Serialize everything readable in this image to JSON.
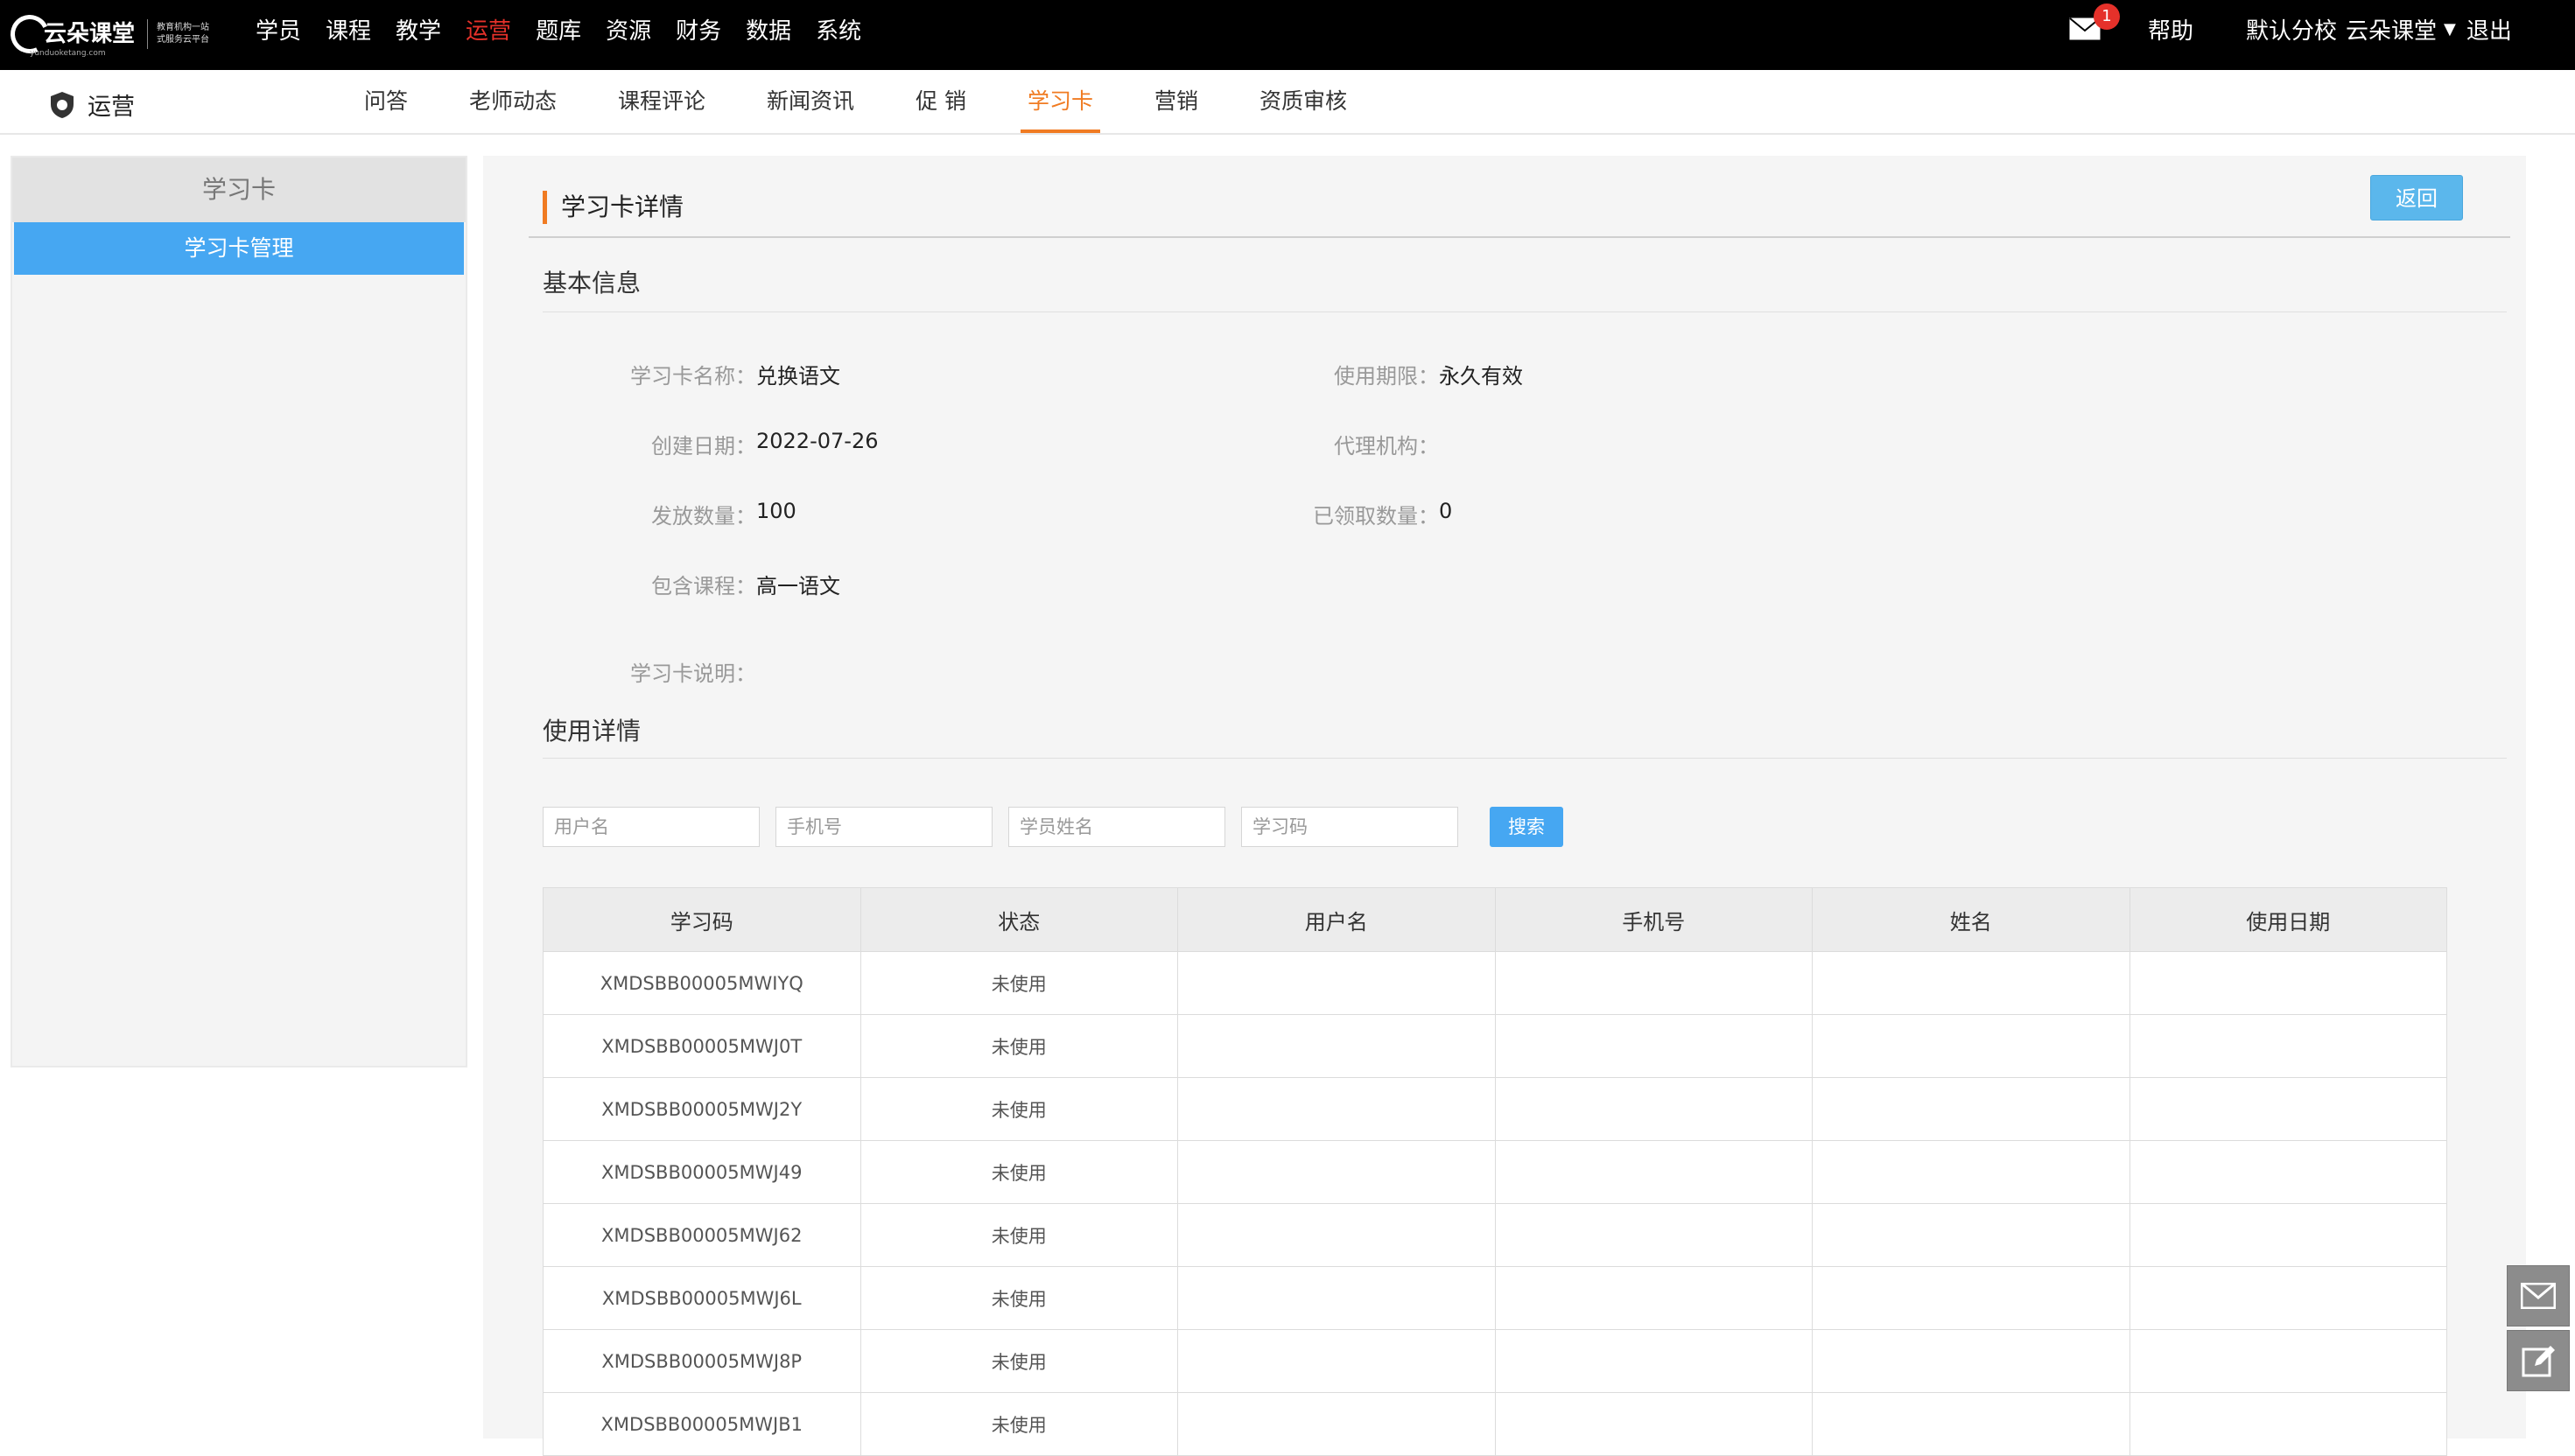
{
  "brand": {
    "name": "云朵课堂",
    "domain": "yunduoketang.com",
    "tagline_line1": "教育机构一站",
    "tagline_line2": "式服务云平台"
  },
  "top_nav": [
    {
      "label": "学员"
    },
    {
      "label": "课程"
    },
    {
      "label": "教学"
    },
    {
      "label": "运营",
      "active": true
    },
    {
      "label": "题库"
    },
    {
      "label": "资源"
    },
    {
      "label": "财务"
    },
    {
      "label": "数据"
    },
    {
      "label": "系统"
    }
  ],
  "header_right": {
    "mail_count": "1",
    "help": "帮助",
    "school": "默认分校",
    "org": "云朵课堂",
    "logout": "退出"
  },
  "module_title": "运营",
  "sub_nav": [
    {
      "label": "问答"
    },
    {
      "label": "老师动态"
    },
    {
      "label": "课程评论"
    },
    {
      "label": "新闻资讯"
    },
    {
      "label": "促 销"
    },
    {
      "label": "学习卡",
      "active": true
    },
    {
      "label": "营销"
    },
    {
      "label": "资质审核"
    }
  ],
  "sidebar": {
    "title": "学习卡",
    "items": [
      {
        "label": "学习卡管理"
      }
    ]
  },
  "panel": {
    "title": "学习卡详情",
    "back": "返回"
  },
  "basic_info": {
    "section_title": "基本信息",
    "card_name_label": "学习卡名称：",
    "card_name": "兑换语文",
    "validity_label": "使用期限：",
    "validity": "永久有效",
    "created_label": "创建日期：",
    "created": "2022-07-26",
    "agency_label": "代理机构：",
    "agency": "",
    "issued_label": "发放数量：",
    "issued": "100",
    "claimed_label": "已领取数量：",
    "claimed": "0",
    "course_label": "包含课程：",
    "course": "高一语文",
    "desc_label": "学习卡说明：",
    "desc": ""
  },
  "usage": {
    "section_title": "使用详情",
    "placeholders": {
      "username": "用户名",
      "phone": "手机号",
      "student_name": "学员姓名",
      "code": "学习码"
    },
    "search": "搜索",
    "columns": [
      "学习码",
      "状态",
      "用户名",
      "手机号",
      "姓名",
      "使用日期"
    ],
    "rows": [
      [
        "XMDSBB00005MWIYQ",
        "未使用",
        "",
        "",
        "",
        ""
      ],
      [
        "XMDSBB00005MWJ0T",
        "未使用",
        "",
        "",
        "",
        ""
      ],
      [
        "XMDSBB00005MWJ2Y",
        "未使用",
        "",
        "",
        "",
        ""
      ],
      [
        "XMDSBB00005MWJ49",
        "未使用",
        "",
        "",
        "",
        ""
      ],
      [
        "XMDSBB00005MWJ62",
        "未使用",
        "",
        "",
        "",
        ""
      ],
      [
        "XMDSBB00005MWJ6L",
        "未使用",
        "",
        "",
        "",
        ""
      ],
      [
        "XMDSBB00005MWJ8P",
        "未使用",
        "",
        "",
        "",
        ""
      ],
      [
        "XMDSBB00005MWJB1",
        "未使用",
        "",
        "",
        "",
        ""
      ]
    ]
  },
  "colors": {
    "accent_orange": "#f07b22",
    "nav_active_red": "#e5312a",
    "primary_blue": "#46a7f2"
  }
}
